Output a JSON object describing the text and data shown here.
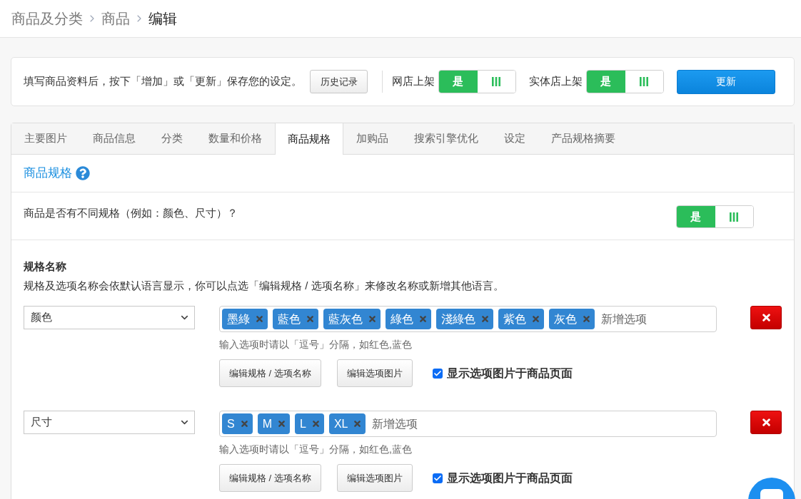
{
  "breadcrumb": [
    {
      "label": "商品及分类",
      "current": false
    },
    {
      "label": "商品",
      "current": false
    },
    {
      "label": "编辑",
      "current": true
    }
  ],
  "toolbar": {
    "note": "填写商品资料后，按下「增加」或「更新」保存您的设定。",
    "history_button": "历史记录",
    "switches": [
      {
        "label": "网店上架",
        "on_label": "是",
        "on": true
      },
      {
        "label": "实体店上架",
        "on_label": "是",
        "on": true
      }
    ],
    "update_button": "更新"
  },
  "tabs": [
    {
      "label": "主要图片",
      "selected": false
    },
    {
      "label": "商品信息",
      "selected": false
    },
    {
      "label": "分类",
      "selected": false
    },
    {
      "label": "数量和价格",
      "selected": false
    },
    {
      "label": "商品规格",
      "selected": true
    },
    {
      "label": "加购品",
      "selected": false
    },
    {
      "label": "搜索引擎优化",
      "selected": false
    },
    {
      "label": "设定",
      "selected": false
    },
    {
      "label": "产品规格摘要",
      "selected": false
    }
  ],
  "section": {
    "title": "商品规格",
    "question": "商品是否有不同规格（例如：颜色、尺寸）？",
    "variants_switch": {
      "on_label": "是",
      "on": true
    }
  },
  "spec_names": {
    "title": "规格名称",
    "description": "规格及选项名称会依默认语言显示，你可以点选「编辑规格 / 选项名称」来修改名称或新增其他语言。",
    "specs": [
      {
        "name": "颜色",
        "tags": [
          "墨綠",
          "藍色",
          "藍灰色",
          "綠色",
          "淺綠色",
          "紫色",
          "灰色"
        ],
        "placeholder": "新增选项",
        "hint": "输入选项时请以「逗号」分隔，如红色,蓝色",
        "edit_names_button": "编辑规格 / 选项名称",
        "edit_images_button": "编辑选项图片",
        "show_images": {
          "label": "显示选项图片于商品页面",
          "checked": true
        }
      },
      {
        "name": "尺寸",
        "tags": [
          "S",
          "M",
          "L",
          "XL"
        ],
        "placeholder": "新增选项",
        "hint": "输入选项时请以「逗号」分隔，如红色,蓝色",
        "edit_names_button": "编辑规格 / 选项名称",
        "edit_images_button": "编辑选项图片",
        "show_images": {
          "label": "显示选项图片于商品页面",
          "checked": true
        }
      }
    ]
  }
}
